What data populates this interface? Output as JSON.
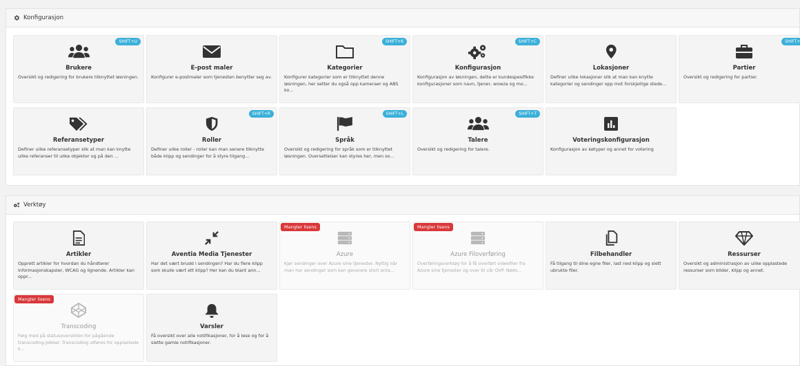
{
  "sections": {
    "config": {
      "title": "Konfigurasjon",
      "tiles": [
        {
          "title": "Brukere",
          "icon": "users-icon",
          "shortcut": "SHIFT+U",
          "desc": "Oversikt og redigering for brukere tilknyttet løsningen."
        },
        {
          "title": "E-post maler",
          "icon": "envelope-icon",
          "shortcut": "",
          "desc": "Konfigurer e-postmaler som tjenesten benytter seg av."
        },
        {
          "title": "Kategorier",
          "icon": "folder-icon",
          "shortcut": "SHIFT+K",
          "desc": "Konfigurer kategorier som er tilknyttet denne løsningen, her setter du også opp kameraer og ABS ko..."
        },
        {
          "title": "Konfigurasjon",
          "icon": "cogs-icon",
          "shortcut": "SHIFT+C",
          "desc": "Konfigurasjon av løsningen, dette er kundespesifikke konfigurasjoner som navn, tjener, wowza og mo..."
        },
        {
          "title": "Lokasjoner",
          "icon": "map-marker-icon",
          "shortcut": "",
          "desc": "Definer ulike lokasjoner slik at man kan knytte kategorier og sendinger opp mot forskjellige stede..."
        },
        {
          "title": "Partier",
          "icon": "briefcase-icon",
          "shortcut": "SHIFT+P",
          "desc": "Oversikt og redigering for partier."
        },
        {
          "title": "Referansetyper",
          "icon": "tags-icon",
          "shortcut": "",
          "desc": "Definer ulike referansetyper slik at man kan knytte ulike referanser til ulike objekter og på den ..."
        },
        {
          "title": "Roller",
          "icon": "shield-icon",
          "shortcut": "SHIFT+R",
          "desc": "Definer ulike roller - roller kan man senere tilknytte både klipp og sendinger for å styre tilgang..."
        },
        {
          "title": "Språk",
          "icon": "flag-icon",
          "shortcut": "SHIFT+L",
          "desc": "Oversikt og redigering for språk som er tilknyttet løsningen. Oversettelser kan styres her, men so..."
        },
        {
          "title": "Talere",
          "icon": "users-icon",
          "shortcut": "SHIFT+T",
          "desc": "Oversikt og redigering for talere."
        },
        {
          "title": "Voteringskonfigurasjon",
          "icon": "chart-icon",
          "shortcut": "",
          "desc": "Konfigurasjon av køtyper og annet for votering"
        }
      ]
    },
    "tools": {
      "title": "Verktøy",
      "tiles": [
        {
          "title": "Artikler",
          "icon": "file-icon",
          "badge": "",
          "desc": "Opprett artikler for hvordan du håndterer informasjonskapsler, WCAG og lignende. Artikler kan oppr..."
        },
        {
          "title": "Aventia Media Tjenester",
          "icon": "compress-icon",
          "badge": "",
          "desc": "Har det vært brudd i sendingen? Har du flere klipp som skulle vært ett klipp? Her kan du blant ann..."
        },
        {
          "title": "Azure",
          "icon": "server-icon",
          "badge": "Mangler lisens",
          "desc": "Kjør sendinger over Azure sine tjenester. Nyttig når man har sendinger som kan generere stort anta..."
        },
        {
          "title": "Azure Filoverføring",
          "icon": "server-icon",
          "badge": "Mangler lisens",
          "desc": "Overføringsverktøy for å få overført videofiler fra Azure sine tjenester og over til vår OVP. Nødv..."
        },
        {
          "title": "Filbehandler",
          "icon": "copy-icon",
          "badge": "",
          "desc": "Få tilgang til dine egne filer, last ned klipp og slett ubrukte filer."
        },
        {
          "title": "Ressurser",
          "icon": "diamond-icon",
          "badge": "",
          "desc": "Oversikt og administrasjon av ulike opplastede ressurser som bilder, klipp og annet."
        },
        {
          "title": "Transcoding",
          "icon": "codepen-icon",
          "badge": "Mangler lisens",
          "desc": "Følg med på statusoversikten for pågående transcoding-jobber. Transcoding utføres for opplastede k..."
        },
        {
          "title": "Varsler",
          "icon": "bell-icon",
          "badge": "",
          "desc": "Få oversikt over alle notifikasjoner, for å lese og for å slette gamle notifikasjoner."
        }
      ]
    }
  }
}
